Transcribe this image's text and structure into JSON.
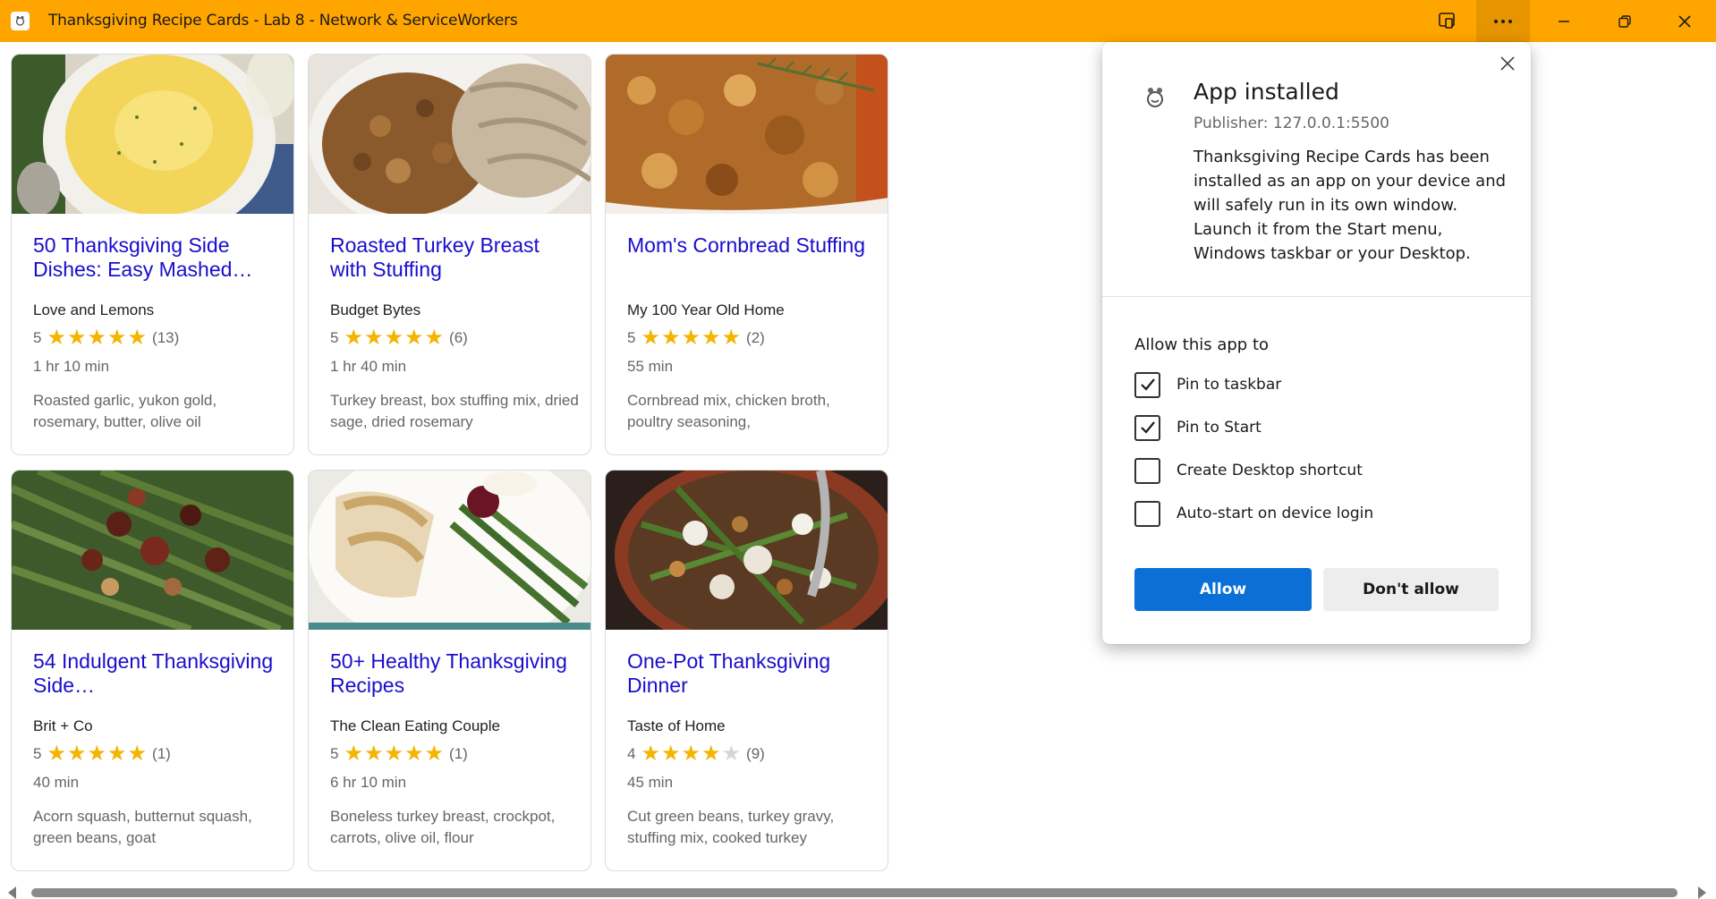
{
  "window": {
    "title": "Thanksgiving Recipe Cards - Lab 8 - Network & ServiceWorkers",
    "accent_color": "#FFA500",
    "icons": [
      "app-icon",
      "cast-icon",
      "more-icon",
      "minimize-icon",
      "maximize-icon",
      "close-icon"
    ]
  },
  "cards": [
    {
      "title": "50 Thanksgiving Side Dishes: Easy Mashed…",
      "source": "Love and Lemons",
      "rating": "5",
      "stars": 5,
      "count": "(13)",
      "time": "1 hr 10 min",
      "ingredients": "Roasted garlic, yukon gold, rosemary, butter, olive oil",
      "image": "mashed-potatoes-photo"
    },
    {
      "title": "Roasted Turkey Breast with Stuffing",
      "source": "Budget Bytes",
      "rating": "5",
      "stars": 5,
      "count": "(6)",
      "time": "1 hr 40 min",
      "ingredients": "Turkey breast, box stuffing mix, dried sage, dried rosemary",
      "image": "turkey-and-stuffing-photo"
    },
    {
      "title": "Mom's Cornbread Stuffing",
      "source": "My 100 Year Old Home",
      "rating": "5",
      "stars": 5,
      "count": "(2)",
      "time": "55 min",
      "ingredients": "Cornbread mix, chicken broth, poultry seasoning,",
      "image": "cornbread-stuffing-photo"
    },
    {
      "title": "54 Indulgent Thanksgiving Side…",
      "source": "Brit + Co",
      "rating": "5",
      "stars": 5,
      "count": "(1)",
      "time": "40 min",
      "ingredients": "Acorn squash, butternut squash, green beans, goat",
      "image": "green-beans-photo"
    },
    {
      "title": "50+ Healthy Thanksgiving Recipes",
      "source": "The Clean Eating Couple",
      "rating": "5",
      "stars": 5,
      "count": "(1)",
      "time": "6 hr 10 min",
      "ingredients": "Boneless turkey breast, crockpot, carrots, olive oil, flour",
      "image": "turkey-plate-photo"
    },
    {
      "title": "One-Pot Thanksgiving Dinner",
      "source": "Taste of Home",
      "rating": "4",
      "stars": 4,
      "count": "(9)",
      "time": "45 min",
      "ingredients": "Cut green beans, turkey gravy, stuffing mix, cooked turkey",
      "image": "one-pot-dinner-photo"
    }
  ],
  "dialog": {
    "title": "App installed",
    "publisher": "Publisher: 127.0.0.1:5500",
    "body": "Thanksgiving Recipe Cards has been installed as an app on your device and will safely run in its own window. Launch it from the Start menu, Windows taskbar or your Desktop.",
    "allow_heading": "Allow this app to",
    "options": [
      {
        "label": "Pin to taskbar",
        "checked": true
      },
      {
        "label": "Pin to Start",
        "checked": true
      },
      {
        "label": "Create Desktop shortcut",
        "checked": false
      },
      {
        "label": "Auto-start on device login",
        "checked": false
      }
    ],
    "allow_label": "Allow",
    "deny_label": "Don't allow",
    "primary_color": "#0A6FD6"
  }
}
